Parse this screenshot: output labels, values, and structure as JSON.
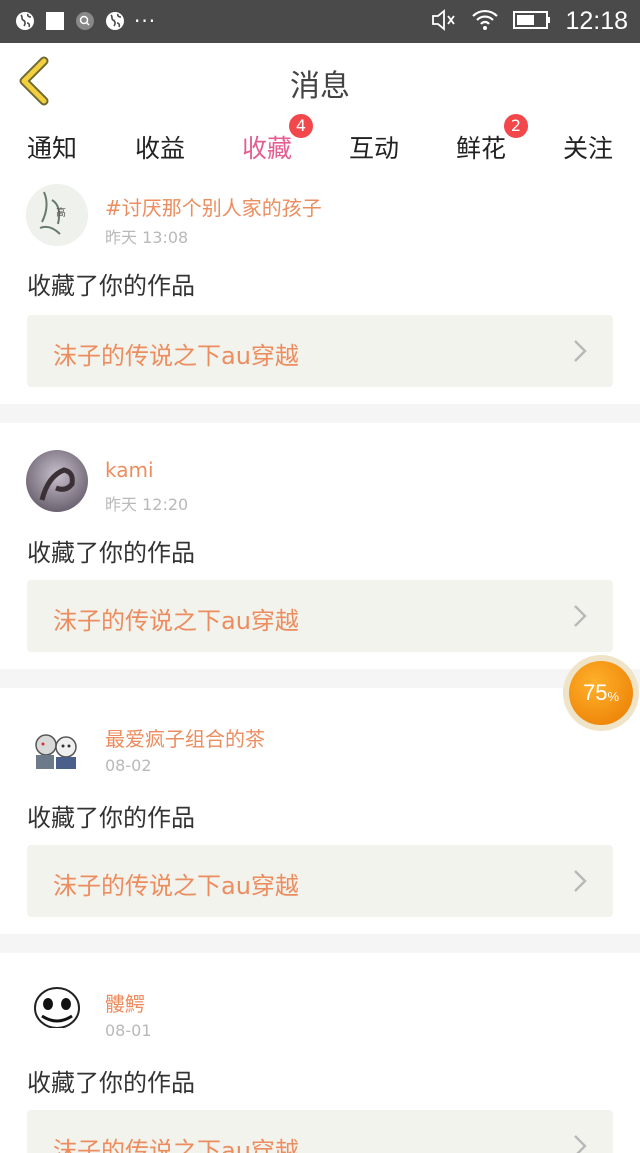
{
  "status_bar": {
    "time": "12:18",
    "more": "···"
  },
  "header": {
    "title": "消息"
  },
  "tabs": [
    {
      "label": "通知",
      "badge": ""
    },
    {
      "label": "收益",
      "badge": ""
    },
    {
      "label": "收藏",
      "badge": "4"
    },
    {
      "label": "互动",
      "badge": ""
    },
    {
      "label": "鲜花",
      "badge": "2"
    },
    {
      "label": "关注",
      "badge": ""
    }
  ],
  "feed": [
    {
      "user": "#讨厌那个别人家的孩子",
      "time": "昨天 13:08",
      "action": "收藏了你的作品",
      "work": "沫子的传说之下au穿越"
    },
    {
      "user": "kami",
      "time": "昨天 12:20",
      "action": "收藏了你的作品",
      "work": "沫子的传说之下au穿越"
    },
    {
      "user": "最爱疯子组合的茶",
      "time": "08-02",
      "action": "收藏了你的作品",
      "work": "沫子的传说之下au穿越"
    },
    {
      "user": "髏鰐",
      "time": "08-01",
      "action": "收藏了你的作品",
      "work": "沫子的传说之下au穿越"
    }
  ],
  "progress": {
    "value": "75",
    "unit": "%"
  },
  "colors": {
    "accent": "#e45f91",
    "name": "#ec8d5f",
    "badge": "#f2474b"
  }
}
